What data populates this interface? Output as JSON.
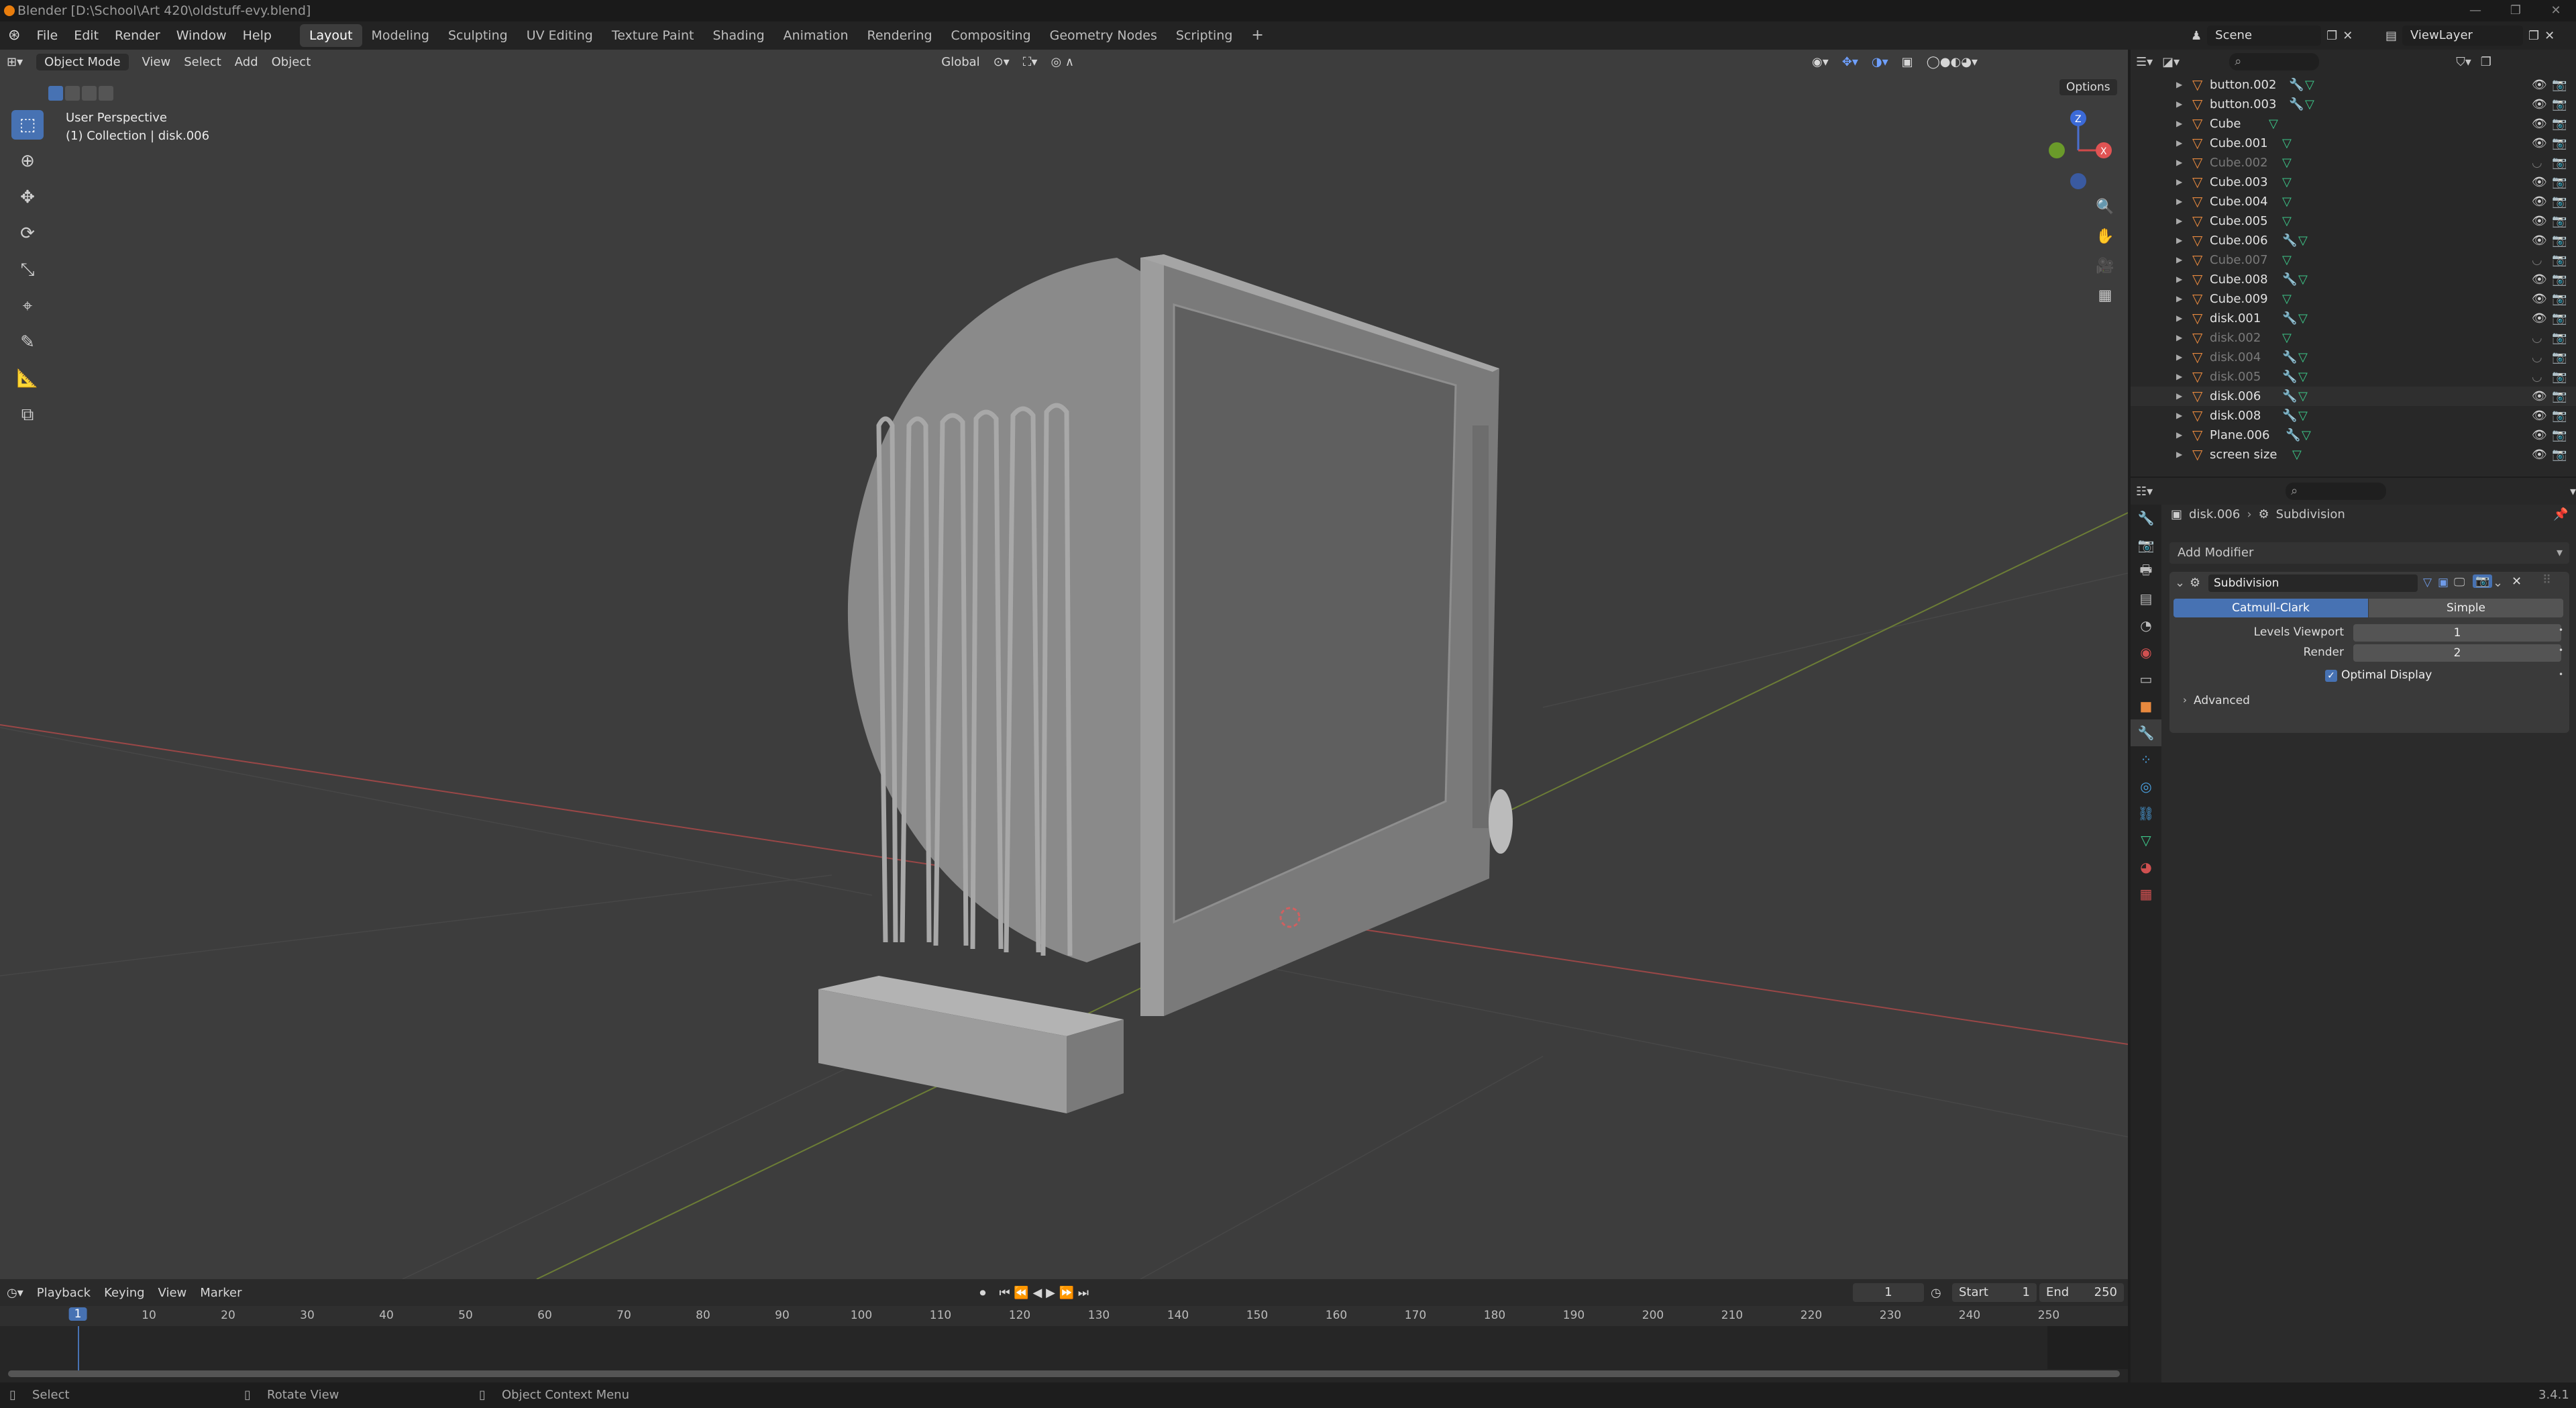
{
  "window": {
    "title": "Blender [D:\\School\\Art 420\\oldstuff-evy.blend]",
    "controls": [
      "—",
      "❐",
      "✕"
    ]
  },
  "menus": [
    "File",
    "Edit",
    "Render",
    "Window",
    "Help"
  ],
  "workspaces": [
    "Layout",
    "Modeling",
    "Sculpting",
    "UV Editing",
    "Texture Paint",
    "Shading",
    "Animation",
    "Rendering",
    "Compositing",
    "Geometry Nodes",
    "Scripting"
  ],
  "active_workspace": "Layout",
  "scene": {
    "name": "Scene",
    "view_layer": "ViewLayer"
  },
  "viewport": {
    "mode": "Object Mode",
    "menus": [
      "View",
      "Select",
      "Add",
      "Object"
    ],
    "transform": "Global",
    "options": "Options",
    "info_line1": "User Perspective",
    "info_line2": "(1) Collection | disk.006",
    "gizmo": {
      "z": "Z",
      "x": "X"
    },
    "tools": [
      "select-box-icon",
      "cursor-icon",
      "move-icon",
      "rotate-icon",
      "scale-icon",
      "transform-icon",
      "annotate-icon",
      "measure-icon",
      "add-cube-icon"
    ]
  },
  "outliner": {
    "rows": [
      {
        "name": "button.002",
        "dim": false,
        "mod": true,
        "mesh": true
      },
      {
        "name": "button.003",
        "dim": false,
        "mod": true,
        "mesh": true
      },
      {
        "name": "Cube",
        "dim": false,
        "mod": false,
        "mesh": true
      },
      {
        "name": "Cube.001",
        "dim": false,
        "mod": false,
        "mesh": true
      },
      {
        "name": "Cube.002",
        "dim": true,
        "mod": false,
        "mesh": true
      },
      {
        "name": "Cube.003",
        "dim": false,
        "mod": false,
        "mesh": true
      },
      {
        "name": "Cube.004",
        "dim": false,
        "mod": false,
        "mesh": true
      },
      {
        "name": "Cube.005",
        "dim": false,
        "mod": false,
        "mesh": true
      },
      {
        "name": "Cube.006",
        "dim": false,
        "mod": true,
        "mesh": true
      },
      {
        "name": "Cube.007",
        "dim": true,
        "mod": false,
        "mesh": true
      },
      {
        "name": "Cube.008",
        "dim": false,
        "mod": true,
        "mesh": true
      },
      {
        "name": "Cube.009",
        "dim": false,
        "mod": false,
        "mesh": true
      },
      {
        "name": "disk.001",
        "dim": false,
        "mod": true,
        "mesh": true
      },
      {
        "name": "disk.002",
        "dim": true,
        "mod": false,
        "mesh": true
      },
      {
        "name": "disk.004",
        "dim": true,
        "mod": true,
        "mesh": true
      },
      {
        "name": "disk.005",
        "dim": true,
        "mod": true,
        "mesh": true
      },
      {
        "name": "disk.006",
        "dim": false,
        "mod": true,
        "mesh": true
      },
      {
        "name": "disk.008",
        "dim": false,
        "mod": true,
        "mesh": true
      },
      {
        "name": "Plane.006",
        "dim": false,
        "mod": true,
        "mesh": true
      },
      {
        "name": "screen size",
        "dim": false,
        "mod": false,
        "mesh": true
      }
    ]
  },
  "properties": {
    "breadcrumb_object": "disk.006",
    "breadcrumb_modifier": "Subdivision",
    "add_modifier": "Add Modifier",
    "modifier_name": "Subdivision",
    "type_options": [
      "Catmull-Clark",
      "Simple"
    ],
    "active_type": "Catmull-Clark",
    "levels_viewport_label": "Levels Viewport",
    "levels_viewport_value": "1",
    "render_label": "Render",
    "render_value": "2",
    "optimal_display_label": "Optimal Display",
    "optimal_display_checked": true,
    "advanced_label": "Advanced"
  },
  "timeline": {
    "menus": [
      "Playback",
      "Keying",
      "View",
      "Marker"
    ],
    "current_frame": "1",
    "start_label": "Start",
    "start": "1",
    "end_label": "End",
    "end": "250",
    "ticks": [
      "10",
      "20",
      "30",
      "40",
      "50",
      "60",
      "70",
      "80",
      "90",
      "100",
      "110",
      "120",
      "130",
      "140",
      "150",
      "160",
      "170",
      "180",
      "190",
      "200",
      "210",
      "220",
      "230",
      "240",
      "250"
    ]
  },
  "statusbar": {
    "select": "Select",
    "rotate": "Rotate View",
    "context": "Object Context Menu",
    "version": "3.4.1"
  },
  "colors": {
    "accent": "#4772b3",
    "mesh_icon": "#3dc98a",
    "object_icon": "#e8893e",
    "x_axis": "#d04a4a",
    "y_axis": "#8ab13a"
  }
}
